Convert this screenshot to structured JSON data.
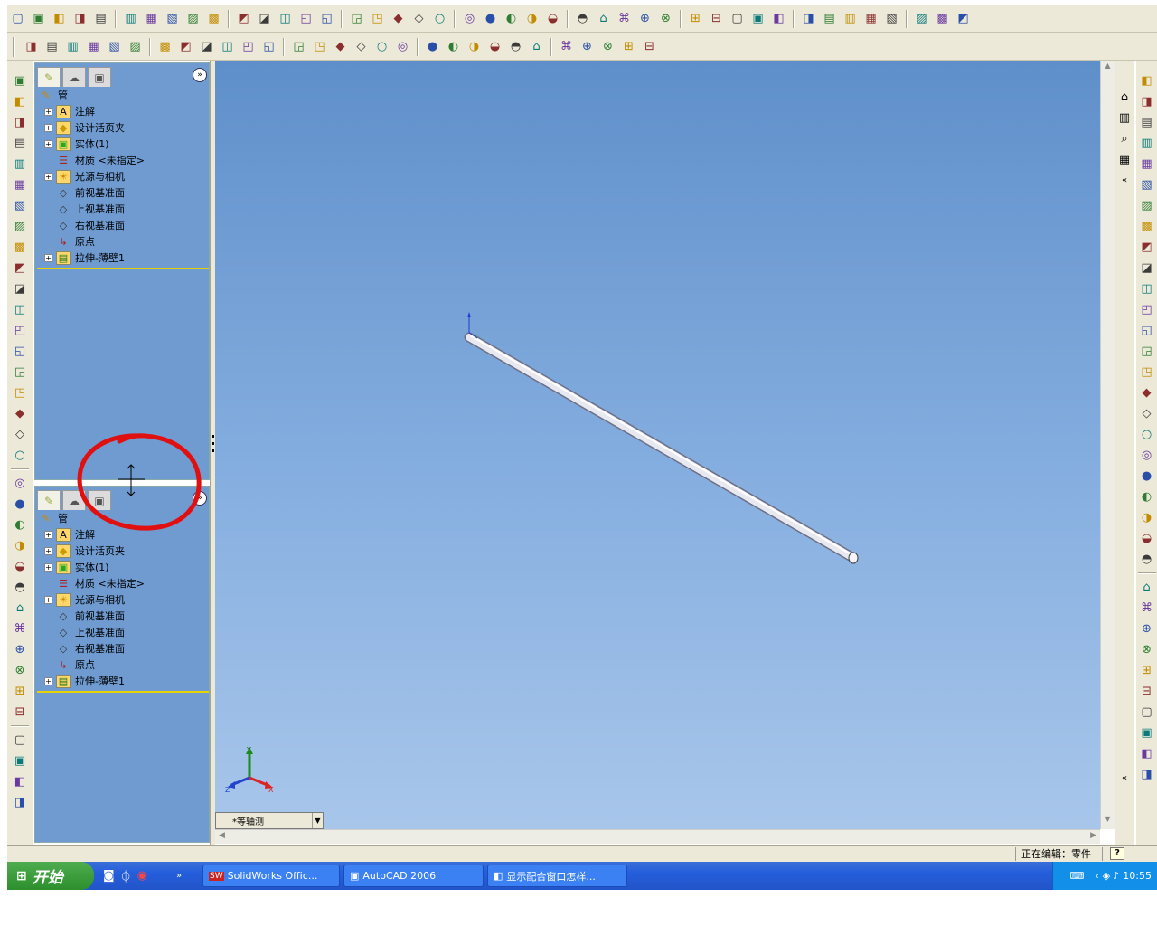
{
  "toolbar_row1": [
    "new-icon",
    "open-icon",
    "save-icon",
    "print-icon",
    "options-icon",
    "preview-icon",
    "print2-icon",
    "undo-icon",
    "redo-icon",
    "select-icon",
    "select2-icon",
    "rebuild-icon",
    "grid-icon",
    "view-icon",
    "cube-icon",
    "window-icon",
    "list-icon",
    "zoom-fit-icon",
    "zoom-area-icon",
    "zoom-icon",
    "rotate-icon",
    "pan-icon",
    "view3d-icon",
    "wireframe-icon",
    "hidden-icon",
    "hidden2-icon",
    "shaded-edges-icon",
    "shaded-icon",
    "perspective-icon",
    "section-icon",
    "camera-icon",
    "measure-icon",
    "mass-icon",
    "check-icon",
    "stats-icon",
    "sum-icon",
    "check2-icon",
    "sim-icon",
    "sketch-icon",
    "line-icon",
    "point-icon",
    "star-icon",
    "extra-icon"
  ],
  "toolbar_row2": [
    "extrude-icon",
    "revolve-icon",
    "sweep-icon",
    "loft-icon",
    "fillet-icon",
    "chamfer-icon",
    "hole-icon",
    "draft-icon",
    "shell-icon",
    "rib-icon",
    "scale-icon",
    "dome-icon",
    "shape-icon",
    "deform-icon",
    "wrap-icon",
    "flex-icon",
    "move-icon",
    "thicken-icon",
    "split-icon",
    "combine-icon",
    "pattern-icon",
    "mirror-icon",
    "curve-icon",
    "play-icon",
    "stop-icon",
    "pause-icon",
    "record-icon",
    "doc-icon",
    "tbl-icon"
  ],
  "left_toolbar_count": 35,
  "right_toolbar_count": 34,
  "top_panel": {
    "root": "管",
    "items": [
      {
        "label": "注解",
        "expandable": true,
        "icon": "annotation-icon"
      },
      {
        "label": "设计活页夹",
        "expandable": true,
        "icon": "binder-icon"
      },
      {
        "label": "实体(1)",
        "expandable": true,
        "icon": "solid-bodies-icon"
      },
      {
        "label": "材质 <未指定>",
        "expandable": false,
        "icon": "material-icon"
      },
      {
        "label": "光源与相机",
        "expandable": true,
        "icon": "lights-icon"
      },
      {
        "label": "前视基准面",
        "expandable": false,
        "icon": "plane-icon"
      },
      {
        "label": "上视基准面",
        "expandable": false,
        "icon": "plane-icon"
      },
      {
        "label": "右视基准面",
        "expandable": false,
        "icon": "plane-icon"
      },
      {
        "label": "原点",
        "expandable": false,
        "icon": "origin-icon"
      },
      {
        "label": "拉伸-薄壁1",
        "expandable": true,
        "icon": "extrude-feature-icon"
      }
    ]
  },
  "bottom_panel": {
    "root": "管",
    "items": [
      {
        "label": "注解",
        "expandable": true,
        "icon": "annotation-icon"
      },
      {
        "label": "设计活页夹",
        "expandable": true,
        "icon": "binder-icon"
      },
      {
        "label": "实体(1)",
        "expandable": true,
        "icon": "solid-bodies-icon"
      },
      {
        "label": "材质 <未指定>",
        "expandable": false,
        "icon": "material-icon"
      },
      {
        "label": "光源与相机",
        "expandable": true,
        "icon": "lights-icon"
      },
      {
        "label": "前视基准面",
        "expandable": false,
        "icon": "plane-icon"
      },
      {
        "label": "上视基准面",
        "expandable": false,
        "icon": "plane-icon"
      },
      {
        "label": "右视基准面",
        "expandable": false,
        "icon": "plane-icon"
      },
      {
        "label": "原点",
        "expandable": false,
        "icon": "origin-icon"
      },
      {
        "label": "拉伸-薄壁1",
        "expandable": true,
        "icon": "extrude-feature-icon"
      }
    ]
  },
  "view_selector": "*等轴测",
  "triad": {
    "x": "X",
    "y": "Y",
    "z": "Z"
  },
  "status": {
    "text": "正在编辑：零件",
    "help": "?"
  },
  "taskbar": {
    "start": "开始",
    "more": "»",
    "tasks": [
      "SolidWorks Offic...",
      "AutoCAD 2006",
      "显示配合窗口怎样..."
    ],
    "clock": "10:55"
  },
  "colors": {
    "viewport_top": "#5f8fca",
    "viewport_bottom": "#a8c6ea",
    "panel": "#6f9bd1",
    "annotation": "#e01010",
    "taskbar": "#245edb"
  }
}
